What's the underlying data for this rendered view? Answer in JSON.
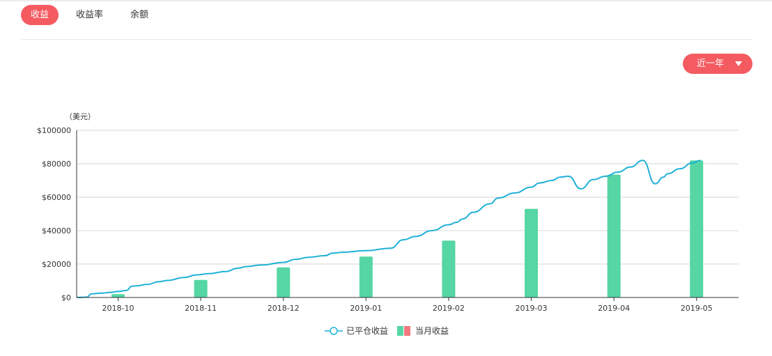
{
  "tabs": [
    {
      "label": "收益",
      "active": true
    },
    {
      "label": "收益率",
      "active": false
    },
    {
      "label": "余额",
      "active": false
    }
  ],
  "range_select": {
    "label": "近一年",
    "icon": "caret-down-icon"
  },
  "colors": {
    "accent": "#f45b61",
    "line": "#1fb1d8",
    "bar": "#55d6a4",
    "bar_alt": "#f07880"
  },
  "chart_data": {
    "type": "bar",
    "unit_label": "（美元）",
    "categories": [
      "2018-10",
      "2018-11",
      "2018-12",
      "2019-01",
      "2019-02",
      "2019-03",
      "2019-04",
      "2019-05"
    ],
    "ylim": [
      0,
      100000
    ],
    "y_ticks": [
      "$100000",
      "$80000",
      "$60000",
      "$40000",
      "$20000",
      "$0"
    ],
    "grid": true,
    "legend_position": "bottom",
    "series": [
      {
        "name": "当月收益",
        "type": "bar",
        "values": [
          2000,
          10500,
          18000,
          24500,
          34000,
          53000,
          73500,
          82000
        ]
      },
      {
        "name": "已平仓收益",
        "type": "line",
        "x": [
          0.0,
          0.12,
          0.18,
          0.3,
          0.4,
          0.5,
          0.6,
          0.67,
          0.72,
          0.85,
          1.0,
          1.1,
          1.3,
          1.45,
          1.6,
          1.8,
          1.95,
          2.05,
          2.25,
          2.5,
          2.65,
          2.8,
          3.0,
          3.1,
          3.2,
          3.5,
          3.8,
          3.95,
          4.1,
          4.3,
          4.5,
          4.6,
          4.67,
          4.8,
          5.0,
          5.1,
          5.3,
          5.5,
          5.6,
          5.75,
          5.85,
          5.95,
          6.1,
          6.25,
          6.4,
          6.55,
          6.7,
          6.85,
          7.0,
          7.1,
          7.15,
          7.3,
          7.45,
          7.55
        ],
        "values": [
          0,
          200,
          2200,
          2600,
          3000,
          3600,
          4200,
          6800,
          7000,
          7800,
          9500,
          10200,
          12000,
          13500,
          14300,
          15500,
          17500,
          18500,
          19500,
          21000,
          22800,
          24000,
          25000,
          26500,
          27000,
          28000,
          29500,
          34500,
          36500,
          40000,
          43500,
          45000,
          47000,
          51000,
          56000,
          59500,
          62500,
          66000,
          68500,
          70000,
          72000,
          72500,
          65000,
          70500,
          72500,
          75000,
          78000,
          82000,
          68000,
          72000,
          74000,
          77000,
          80500,
          82000
        ]
      }
    ]
  }
}
